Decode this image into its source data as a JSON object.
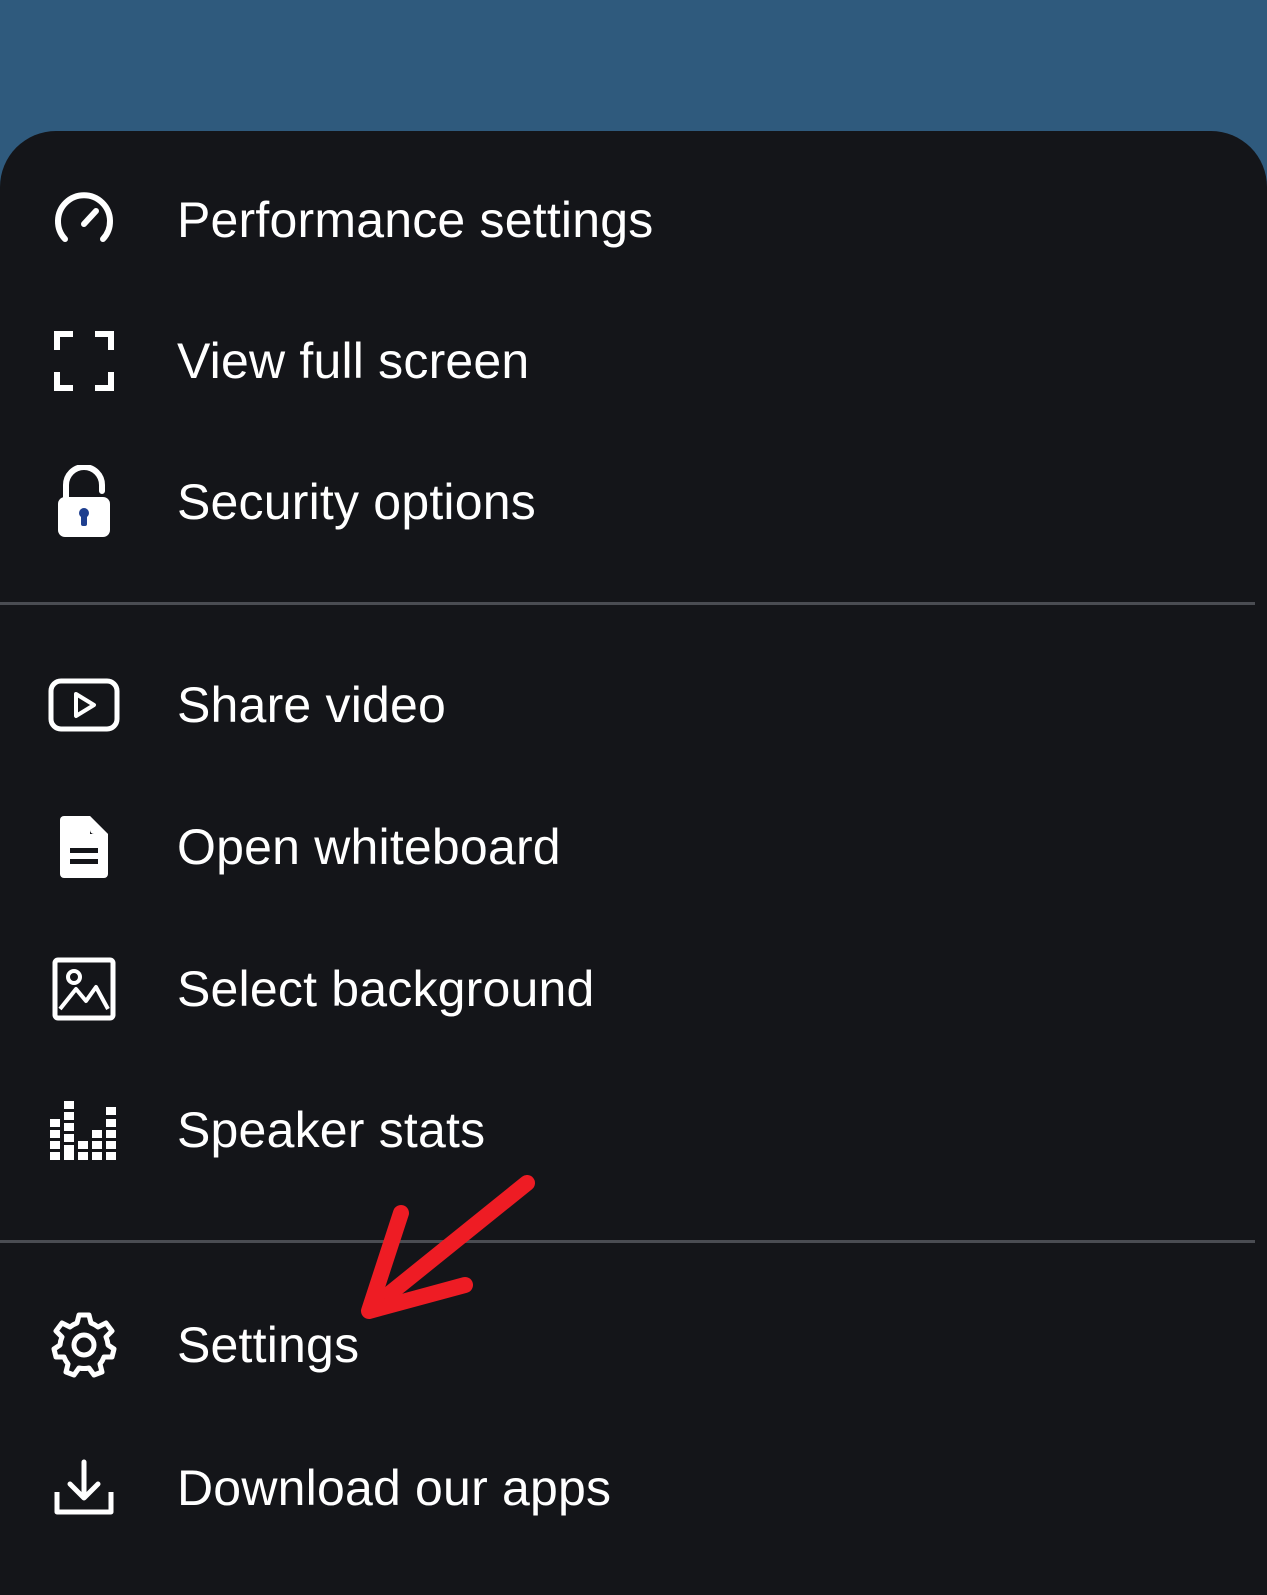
{
  "menu": {
    "items": [
      {
        "label": "Performance settings",
        "icon": "speedometer-icon"
      },
      {
        "label": "View full screen",
        "icon": "fullscreen-icon"
      },
      {
        "label": "Security options",
        "icon": "unlock-icon"
      },
      {
        "label": "Share video",
        "icon": "play-video-icon"
      },
      {
        "label": "Open whiteboard",
        "icon": "document-icon"
      },
      {
        "label": "Select background",
        "icon": "image-icon"
      },
      {
        "label": "Speaker stats",
        "icon": "bar-stats-icon"
      },
      {
        "label": "Settings",
        "icon": "gear-icon"
      },
      {
        "label": "Download our apps",
        "icon": "download-icon"
      }
    ]
  },
  "colors": {
    "backdrop": "#2f5a7d",
    "sheet": "#141519",
    "text": "#ffffff",
    "divider": "#4a4c52",
    "annotation": "#ee1c24"
  },
  "annotation": {
    "icon": "red-arrow-pointing-to-settings"
  }
}
